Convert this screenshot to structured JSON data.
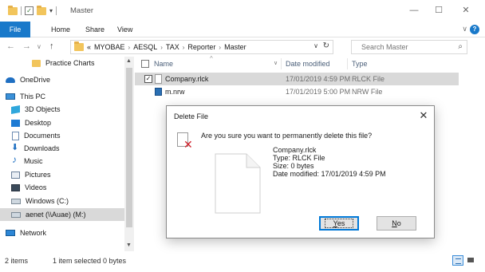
{
  "window": {
    "title": "Master",
    "controls": {
      "minimize": "—",
      "maximize": "☐",
      "close": "✕"
    }
  },
  "ribbon": {
    "tabs": [
      "File",
      "Home",
      "Share",
      "View"
    ],
    "file_tab_color": "#1979ca",
    "help": "?"
  },
  "navigation": {
    "back": "←",
    "forward": "→",
    "recent": "∨",
    "up": "↑",
    "overflow": "«",
    "breadcrumbs": [
      "MYOBAE",
      "AESQL",
      "TAX",
      "Reporter",
      "Master"
    ],
    "separator": "›",
    "dropdown": "∨",
    "refresh": "↻"
  },
  "search": {
    "placeholder": "Search Master",
    "icon": "search-icon"
  },
  "sidebar": {
    "items": [
      {
        "label": "Practice Charts",
        "icon": "folder-icon"
      },
      {
        "label": "OneDrive",
        "icon": "cloud-icon"
      },
      {
        "label": "This PC",
        "icon": "computer-icon"
      },
      {
        "label": "3D Objects",
        "icon": "3d-objects-icon"
      },
      {
        "label": "Desktop",
        "icon": "desktop-icon"
      },
      {
        "label": "Documents",
        "icon": "documents-icon"
      },
      {
        "label": "Downloads",
        "icon": "downloads-icon"
      },
      {
        "label": "Music",
        "icon": "music-icon"
      },
      {
        "label": "Pictures",
        "icon": "pictures-icon"
      },
      {
        "label": "Videos",
        "icon": "videos-icon"
      },
      {
        "label": "Windows (C:)",
        "icon": "drive-icon"
      },
      {
        "label": "aenet (\\\\Auae) (M:)",
        "icon": "network-drive-icon",
        "selected": true
      },
      {
        "label": "Network",
        "icon": "network-icon"
      }
    ],
    "scroll_up": "▲",
    "scroll_down": "▼"
  },
  "file_list": {
    "columns": {
      "name": "Name",
      "date": "Date modified",
      "type": "Type"
    },
    "sort_indicator": "^",
    "name_dropdown": "∨",
    "rows": [
      {
        "name": "Company.rlck",
        "date": "17/01/2019 4:59 PM",
        "type": "RLCK File",
        "selected": true,
        "checked": "✓"
      },
      {
        "name": "m.nrw",
        "date": "17/01/2019 5:00 PM",
        "type": "NRW File",
        "selected": false
      }
    ]
  },
  "statusbar": {
    "items": "2 items",
    "selected": "1 item selected  0 bytes"
  },
  "dialog": {
    "title": "Delete File",
    "close": "✕",
    "question": "Are you sure you want to permanently delete this file?",
    "warning_mark": "✕",
    "file_info": {
      "name": "Company.rlck",
      "type": "Type: RLCK File",
      "size": "Size: 0 bytes",
      "modified": "Date modified: 17/01/2019 4:59 PM"
    },
    "yes_button": {
      "accel": "Y",
      "rest": "es"
    },
    "no_button": {
      "accel": "N",
      "rest": "o"
    }
  }
}
